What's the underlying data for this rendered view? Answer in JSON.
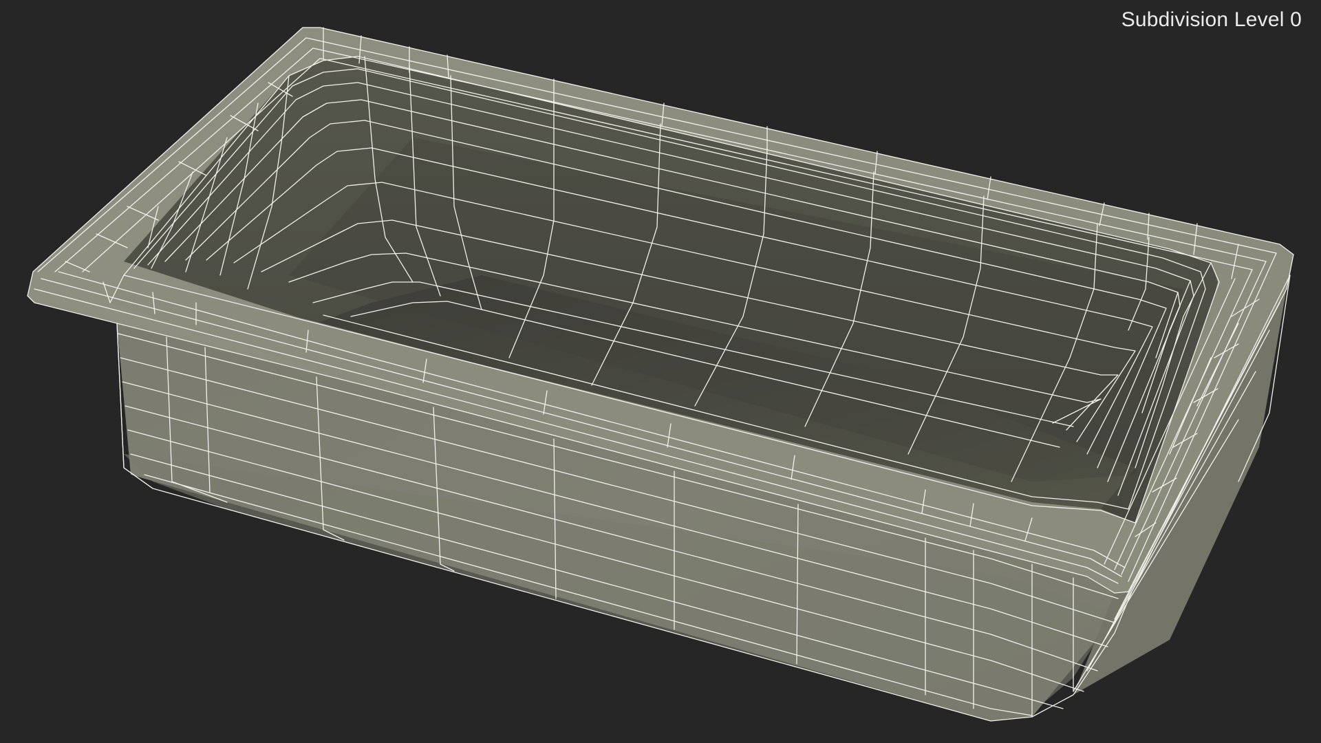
{
  "viewport": {
    "overlay_label": "Subdivision Level 0",
    "background_color": "#262626"
  },
  "model": {
    "object": "bathtub-icon",
    "display_mode": "wireframe-on-shaded",
    "colors": {
      "rim": "#8c8d7e",
      "rim_edge": "#7d7e70",
      "inner_wall": "#5b5c51",
      "inner_floor": "#4a4b42",
      "outer_wall": "#818275",
      "wire": "#f2f2ec"
    }
  }
}
